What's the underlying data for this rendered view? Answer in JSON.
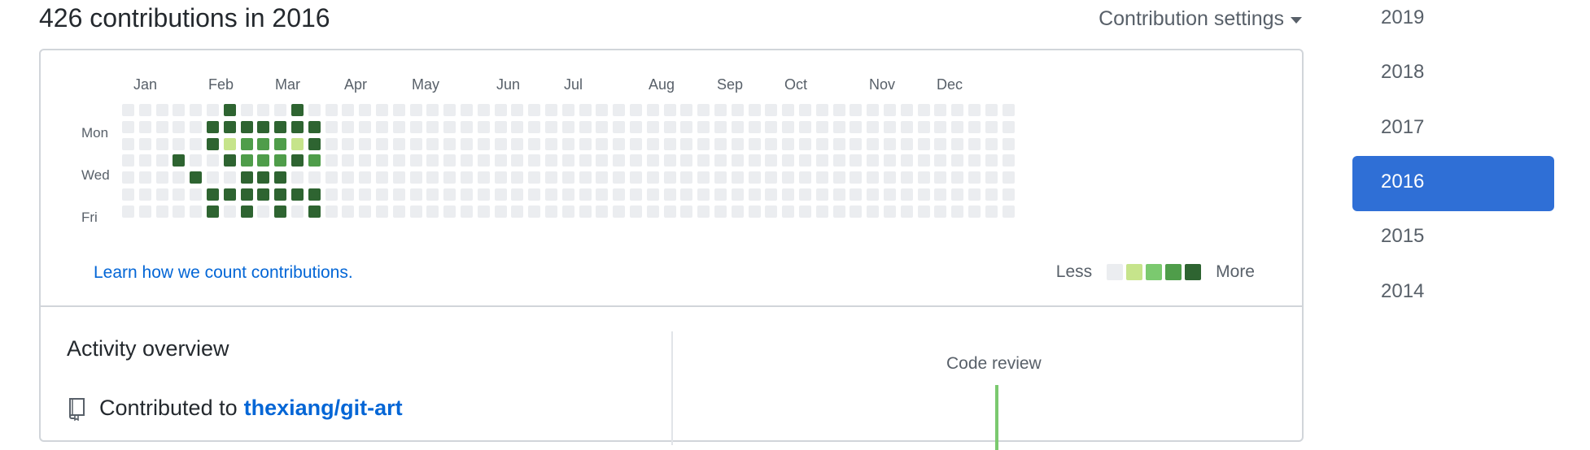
{
  "header": {
    "title": "426 contributions in 2016",
    "settings_label": "Contribution settings"
  },
  "calendar": {
    "months": [
      "Jan",
      "Feb",
      "Mar",
      "Apr",
      "May",
      "Jun",
      "Jul",
      "Aug",
      "Sep",
      "Oct",
      "Nov",
      "Dec"
    ],
    "days": [
      "Mon",
      "Wed",
      "Fri"
    ],
    "weeks": 53,
    "active_weeks": [
      {
        "week": 3,
        "levels": [
          0,
          0,
          0,
          4,
          0,
          0,
          0
        ]
      },
      {
        "week": 4,
        "levels": [
          0,
          0,
          0,
          0,
          4,
          0,
          0
        ]
      },
      {
        "week": 5,
        "levels": [
          0,
          4,
          4,
          0,
          0,
          4,
          4
        ]
      },
      {
        "week": 6,
        "levels": [
          4,
          4,
          1,
          4,
          0,
          4,
          0
        ]
      },
      {
        "week": 7,
        "levels": [
          0,
          4,
          3,
          3,
          4,
          4,
          4
        ]
      },
      {
        "week": 8,
        "levels": [
          0,
          4,
          3,
          3,
          4,
          4,
          0
        ]
      },
      {
        "week": 9,
        "levels": [
          0,
          4,
          3,
          3,
          4,
          4,
          4
        ]
      },
      {
        "week": 10,
        "levels": [
          4,
          4,
          1,
          4,
          0,
          4,
          0
        ]
      },
      {
        "week": 11,
        "levels": [
          0,
          4,
          4,
          3,
          0,
          4,
          4
        ]
      }
    ],
    "colors": [
      "#ebedf0",
      "#c6e48b",
      "#7bc96f",
      "#4f9d4a",
      "#2e6431"
    ],
    "learn_link": "Learn how we count contributions.",
    "legend_less": "Less",
    "legend_more": "More"
  },
  "activity": {
    "title": "Activity overview",
    "contributed_to": "Contributed to",
    "repo": "thexiang/git-art",
    "code_review_label": "Code review"
  },
  "years": [
    "2019",
    "2018",
    "2017",
    "2016",
    "2015",
    "2014"
  ],
  "selected_year": "2016"
}
